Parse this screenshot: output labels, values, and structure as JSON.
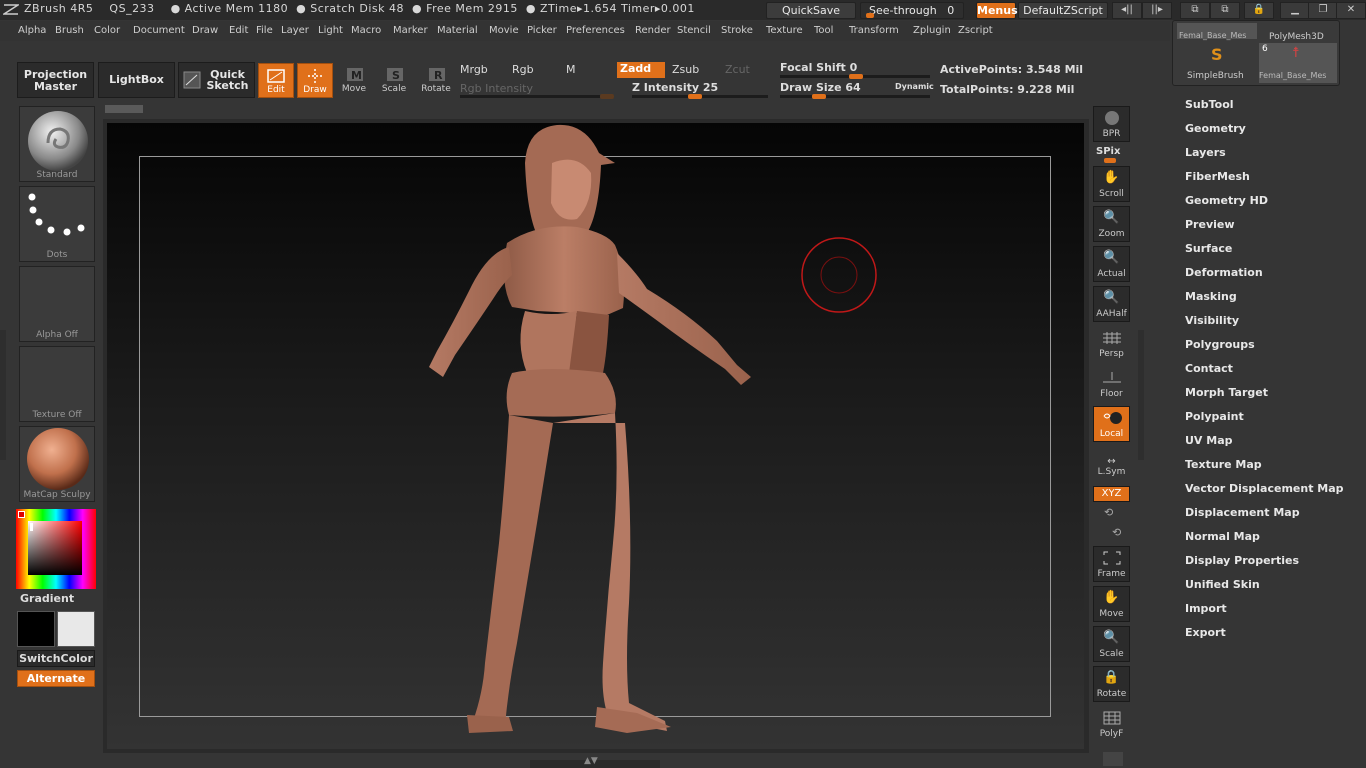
{
  "app": {
    "title": "ZBrush 4R5",
    "file": "QS_233",
    "active_mem": "● Active Mem 1180",
    "scratch_disk": "● Scratch Disk 48",
    "free_mem": "● Free Mem 2915",
    "ztime": "● ZTime▸1.654 Timer▸0.001"
  },
  "topright": {
    "quicksave": "QuickSave",
    "see_through": "See-through",
    "see_through_value": "0",
    "menus": "Menus",
    "default_zscript": "DefaultZScript"
  },
  "menubar": [
    "Alpha",
    "Brush",
    "Color",
    "Document",
    "Draw",
    "Edit",
    "File",
    "Layer",
    "Light",
    "Macro",
    "Marker",
    "Material",
    "Movie",
    "Picker",
    "Preferences",
    "Render",
    "Stencil",
    "Stroke",
    "Texture",
    "Tool",
    "Transform",
    "Zplugin",
    "Zscript"
  ],
  "toolbar": {
    "projection_master_1": "Projection",
    "projection_master_2": "Master",
    "lightbox": "LightBox",
    "quick_sketch_1": "Quick",
    "quick_sketch_2": "Sketch",
    "edit": "Edit",
    "draw": "Draw",
    "move": "Move",
    "scale": "Scale",
    "rotate": "Rotate",
    "mrgb": "Mrgb",
    "rgb": "Rgb",
    "m": "M",
    "rgb_intensity": "Rgb Intensity",
    "zadd": "Zadd",
    "zsub": "Zsub",
    "zcut": "Zcut",
    "z_intensity": "Z Intensity 25",
    "focal_shift": "Focal Shift",
    "focal_shift_value": "0",
    "draw_size": "Draw Size",
    "draw_size_value": "64",
    "dynamic": "Dynamic",
    "active_points": "ActivePoints: 3.548 Mil",
    "total_points": "TotalPoints: 9.228 Mil"
  },
  "left": {
    "brush_label": "Standard",
    "stroke_label": "Dots",
    "alpha_label": "Alpha  Off",
    "texture_label": "Texture  Off",
    "material_label": "MatCap  Sculpy",
    "gradient": "Gradient",
    "switch_color": "SwitchColor",
    "alternate": "Alternate"
  },
  "right_shelf": {
    "bpr": "BPR",
    "spix": "SPix",
    "scroll": "Scroll",
    "zoom": "Zoom",
    "actual": "Actual",
    "aahalf": "AAHalf",
    "persp": "Persp",
    "floor": "Floor",
    "local": "Local",
    "lsym": "L.Sym",
    "xyz": "XYZ",
    "frame": "Frame",
    "move": "Move",
    "scale": "Scale",
    "rotate": "Rotate",
    "polyf": "PolyF"
  },
  "tool_popup": {
    "thumb1": "Femal_Base_Mes",
    "thumb2": "PolyMesh3D",
    "thumb3": "SimpleBrush",
    "thumb4": "Femal_Base_Mes",
    "thumb4_count": "6"
  },
  "tool_palette": [
    "SubTool",
    "Geometry",
    "Layers",
    "FiberMesh",
    "Geometry HD",
    "Preview",
    "Surface",
    "Deformation",
    "Masking",
    "Visibility",
    "Polygroups",
    "Contact",
    "Morph Target",
    "Polypaint",
    "UV Map",
    "Texture Map",
    "Vector Displacement Map",
    "Displacement Map",
    "Normal Map",
    "Display Properties",
    "Unified Skin",
    "Import",
    "Export"
  ],
  "colors": {
    "accent": "#e0701a",
    "skin": "#b57a64",
    "panel": "#353535"
  }
}
